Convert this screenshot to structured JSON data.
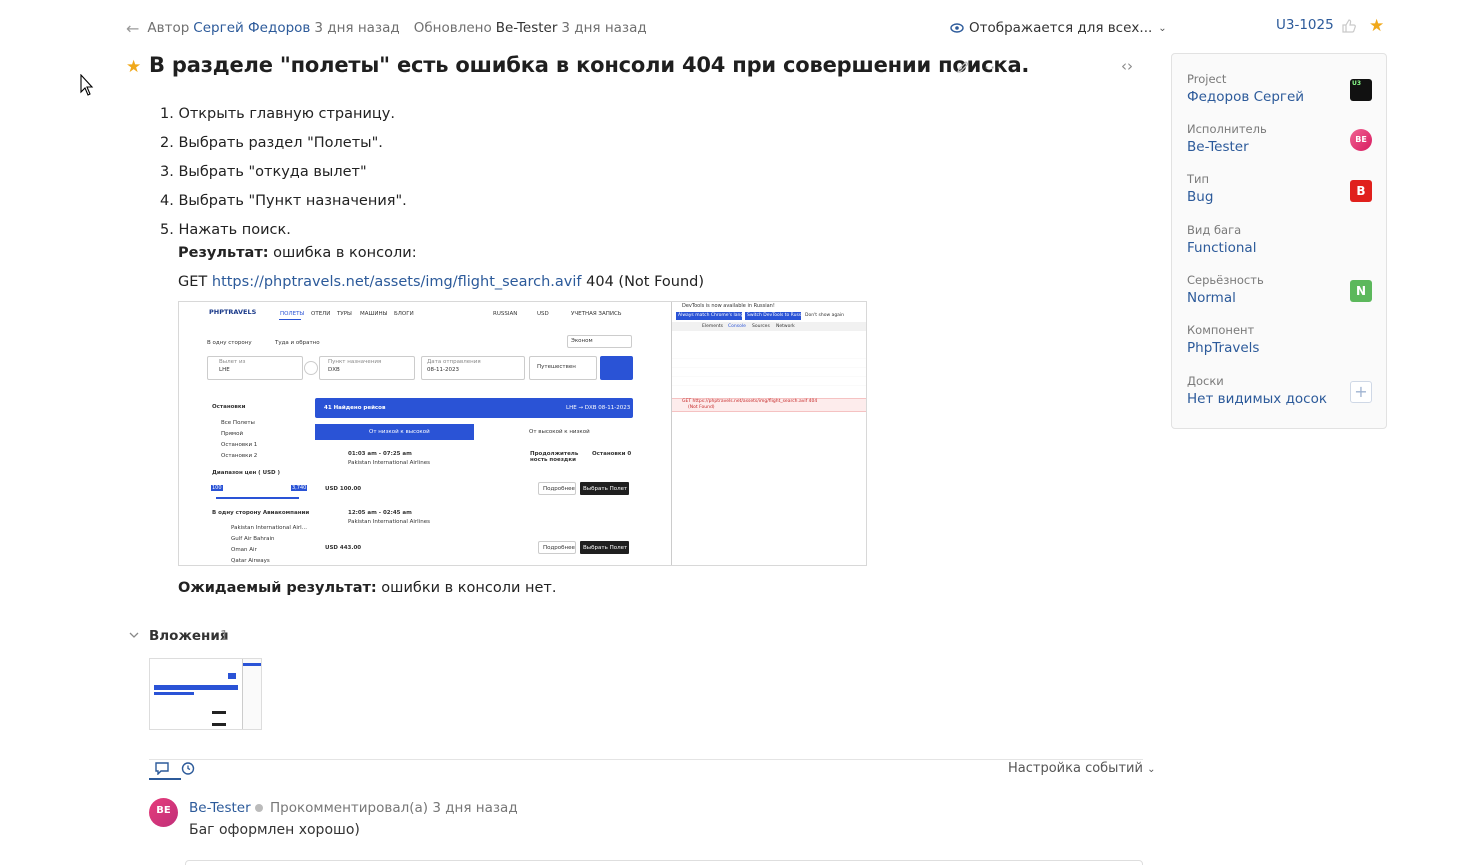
{
  "topbar": {
    "author_prefix": "Автор",
    "author_name": "Сергей Федоров",
    "author_time": "3 дня назад",
    "updated_prefix": "Обновлено",
    "updated_by": "Be-Tester",
    "updated_time": "3 дня назад",
    "visibility": "Отображается для всех...",
    "issue_id": "U3-1025"
  },
  "issue": {
    "title": "В разделе \"полеты\" есть ошибка в консоли 404 при совершении поиска.",
    "steps": [
      "1. Открыть главную страницу.",
      "2. Выбрать раздел \"Полеты\".",
      "3. Выбрать \"откуда вылет\"",
      "4. Выбрать \"Пункт назначения\".",
      "5. Нажать поиск."
    ],
    "result_label": "Результат:",
    "result_text": " ошибка в консоли:",
    "get_prefix": "GET ",
    "get_url": "https://phptravels.net/assets/img/flight_search.avif",
    "get_status": " 404 (Not Found)",
    "expected_label": "Ожидаемый результат:",
    "expected_text": " ошибки в консоли нет."
  },
  "screenshot": {
    "logo": "PHPTRAVELS",
    "nav": [
      "ПОЛЕТЫ",
      "ОТЕЛИ",
      "ТУРЫ",
      "МАШИНЫ",
      "БЛОГИ"
    ],
    "lang": "RUSSIAN",
    "currency": "USD",
    "account": "УЧЕТНАЯ ЗАПИСЬ",
    "trip_one": "В одну сторону",
    "trip_round": "Туда и обратно",
    "cabin": "Эконом",
    "from_label": "Вылет из",
    "from_val": "LHE",
    "to_label": "Пункт назначения",
    "to_val": "DXB",
    "date_label": "Дата отправления",
    "date_val": "08-11-2023",
    "travellers": "Путешествен",
    "stops_title": "Остановки",
    "stops": [
      "Все Полеты",
      "Прямой",
      "Остановки 1",
      "Остановки 2"
    ],
    "price_title": "Диапазон цен ( USD )",
    "price_min": "100",
    "price_max": "3,740",
    "airlines_title": "В одну сторону Авиакомпании",
    "airlines": [
      "Pakistan International Airl...",
      "Gulf Air Bahrain",
      "Oman Air",
      "Qatar Airways"
    ],
    "found": "41 Найдено рейсов",
    "route": "LHE → DXB  08-11-2023",
    "sort_low": "От низкой к высокой",
    "sort_high": "От высокой к низкой",
    "flight1_time": "01:03 am - 07:25 am",
    "flight1_airline": "Pakistan International Airlines",
    "flight1_price": "USD 100.00",
    "flight2_time": "12:05 am - 02:45 am",
    "flight2_airline": "Pakistan International Airlines",
    "flight2_price": "USD 443.00",
    "duration": "Продолжитель ность поездки",
    "stops_col": "Остановки 0",
    "details_btn": "Подробнее",
    "select_btn": "Выбрать Полет",
    "dt_notice": "DevTools is now available in Russian!",
    "dt_btn1": "Always match Chrome's language",
    "dt_btn2": "Switch DevTools to Russian",
    "dt_dont": "Don't show again",
    "dt_tabs": [
      "Elements",
      "Console",
      "Sources",
      "Network"
    ],
    "dt_error": "GET https://phptravels.net/assets/img/flight_search.avif 404",
    "dt_error2": "(Not Found)"
  },
  "attachments": {
    "title": "Вложения",
    "count": "1"
  },
  "activity": {
    "events_setting": "Настройка событий"
  },
  "comment": {
    "avatar": "BE",
    "author": "Be-Tester",
    "meta": "Прокомментировал(а) 3 дня назад",
    "text": "Баг оформлен хорошо)"
  },
  "sidebar": {
    "fields": [
      {
        "label": "Project",
        "value": "Федоров Сергей",
        "badge": "U3",
        "badge_color": "#111111"
      },
      {
        "label": "Исполнитель",
        "value": "Be-Tester",
        "badge": "BE",
        "badge_color": "#e0407a"
      },
      {
        "label": "Тип",
        "value": "Bug",
        "badge": "B",
        "badge_color": "#e0201c"
      },
      {
        "label": "Вид бага",
        "value": "Functional",
        "badge": "",
        "badge_color": ""
      },
      {
        "label": "Серьёзность",
        "value": "Normal",
        "badge": "N",
        "badge_color": "#5cb85c"
      },
      {
        "label": "Компонент",
        "value": "PhpTravels",
        "badge": "",
        "badge_color": ""
      },
      {
        "label": "Доски",
        "value": "Нет видимых досок",
        "badge": "+",
        "badge_color": ""
      }
    ]
  },
  "colors": {
    "accent": "#2c5a9a",
    "star": "#f0a81a",
    "site_blue": "#2a53d6"
  }
}
